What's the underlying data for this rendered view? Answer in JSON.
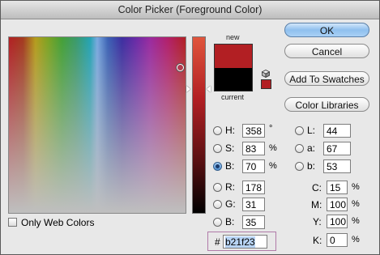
{
  "window": {
    "title": "Color Picker (Foreground Color)"
  },
  "preview": {
    "new_label": "new",
    "current_label": "current",
    "new_color": "#b21f23",
    "current_color": "#000000"
  },
  "buttons": {
    "ok": "OK",
    "cancel": "Cancel",
    "add_to_swatches": "Add To Swatches",
    "color_libraries": "Color Libraries"
  },
  "hsb": {
    "h": {
      "label": "H:",
      "value": "358",
      "unit": "°"
    },
    "s": {
      "label": "S:",
      "value": "83",
      "unit": "%"
    },
    "b": {
      "label": "B:",
      "value": "70",
      "unit": "%"
    }
  },
  "rgb": {
    "r": {
      "label": "R:",
      "value": "178"
    },
    "g": {
      "label": "G:",
      "value": "31"
    },
    "b": {
      "label": "B:",
      "value": "35"
    }
  },
  "lab": {
    "l": {
      "label": "L:",
      "value": "44"
    },
    "a": {
      "label": "a:",
      "value": "67"
    },
    "b": {
      "label": "b:",
      "value": "53"
    }
  },
  "cmyk": {
    "c": {
      "label": "C:",
      "value": "15",
      "unit": "%"
    },
    "m": {
      "label": "M:",
      "value": "100",
      "unit": "%"
    },
    "y": {
      "label": "Y:",
      "value": "100",
      "unit": "%"
    },
    "k": {
      "label": "K:",
      "value": "0",
      "unit": "%"
    }
  },
  "hex": {
    "label": "#",
    "value": "b21f23"
  },
  "only_web_colors": {
    "label": "Only Web Colors",
    "checked": false
  },
  "selected_mode": "B"
}
